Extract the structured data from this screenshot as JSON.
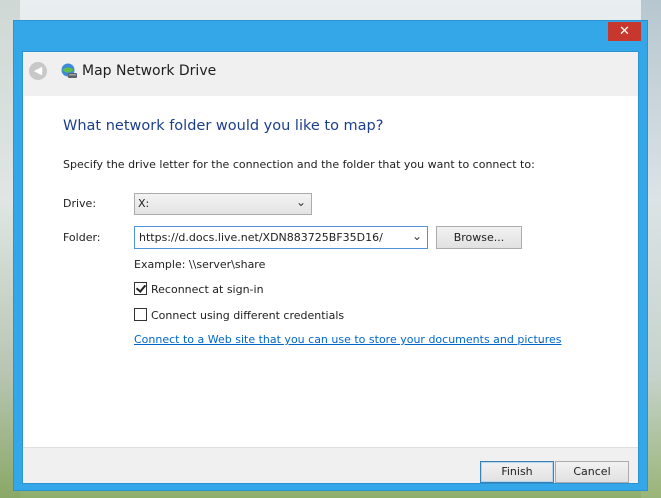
{
  "window": {
    "close_glyph": "✕"
  },
  "header": {
    "title": "Map Network Drive",
    "back_icon": "back-arrow-icon",
    "app_icon": "network-drive-icon"
  },
  "main": {
    "heading": "What network folder would you like to map?",
    "instructions": "Specify the drive letter for the connection and the folder that you want to connect to:",
    "drive": {
      "label": "Drive:",
      "selected": "X:"
    },
    "folder": {
      "label": "Folder:",
      "value": "https://d.docs.live.net/XDN883725BF35D16/",
      "browse_label": "Browse..."
    },
    "example": "Example: \\\\server\\share",
    "reconnect": {
      "label": "Reconnect at sign-in",
      "checked": true
    },
    "credentials": {
      "label": "Connect using different credentials",
      "checked": false
    },
    "web_link": "Connect to a Web site that you can use to store your documents and pictures",
    "web_link_tail": "."
  },
  "footer": {
    "finish_label": "Finish",
    "cancel_label": "Cancel"
  },
  "colors": {
    "titlebar": "#33a7e8",
    "close": "#c7372e",
    "heading": "#1d3e8c",
    "link": "#0066cc"
  }
}
